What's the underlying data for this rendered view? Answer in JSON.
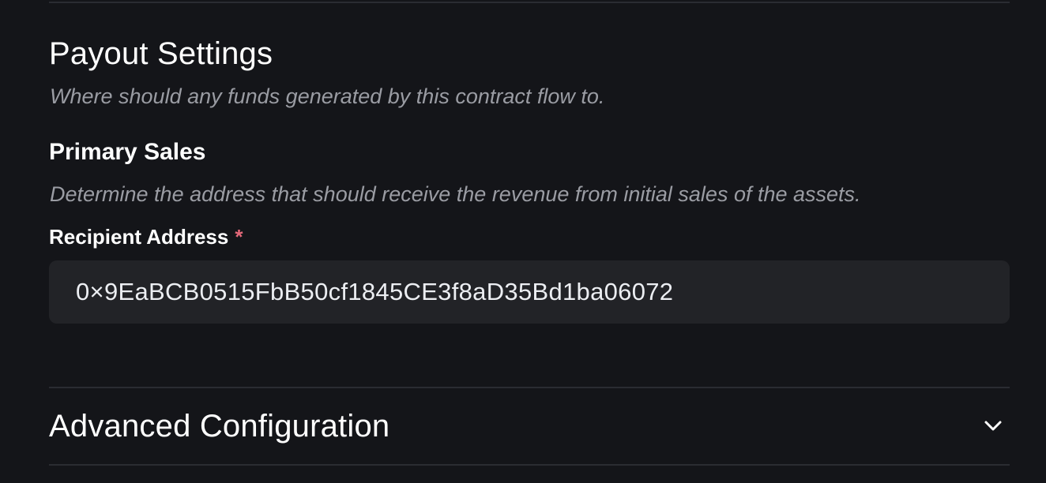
{
  "payout_settings": {
    "title": "Payout Settings",
    "subtitle": "Where should any funds generated by this contract flow to."
  },
  "primary_sales": {
    "heading": "Primary Sales",
    "description": "Determine the address that should receive the revenue from initial sales of the assets.",
    "recipient_label": "Recipient Address",
    "required_marker": "*",
    "recipient_value": "0×9EaBCB0515FbB50cf1845CE3f8aD35Bd1ba06072"
  },
  "advanced_configuration": {
    "title": "Advanced Configuration",
    "toggle_icon": "chevron-down-icon"
  },
  "colors": {
    "background": "#141519",
    "input_background": "#222327",
    "divider": "#2a2c32",
    "muted_text": "#9a9ca3",
    "required": "#e5697a"
  }
}
